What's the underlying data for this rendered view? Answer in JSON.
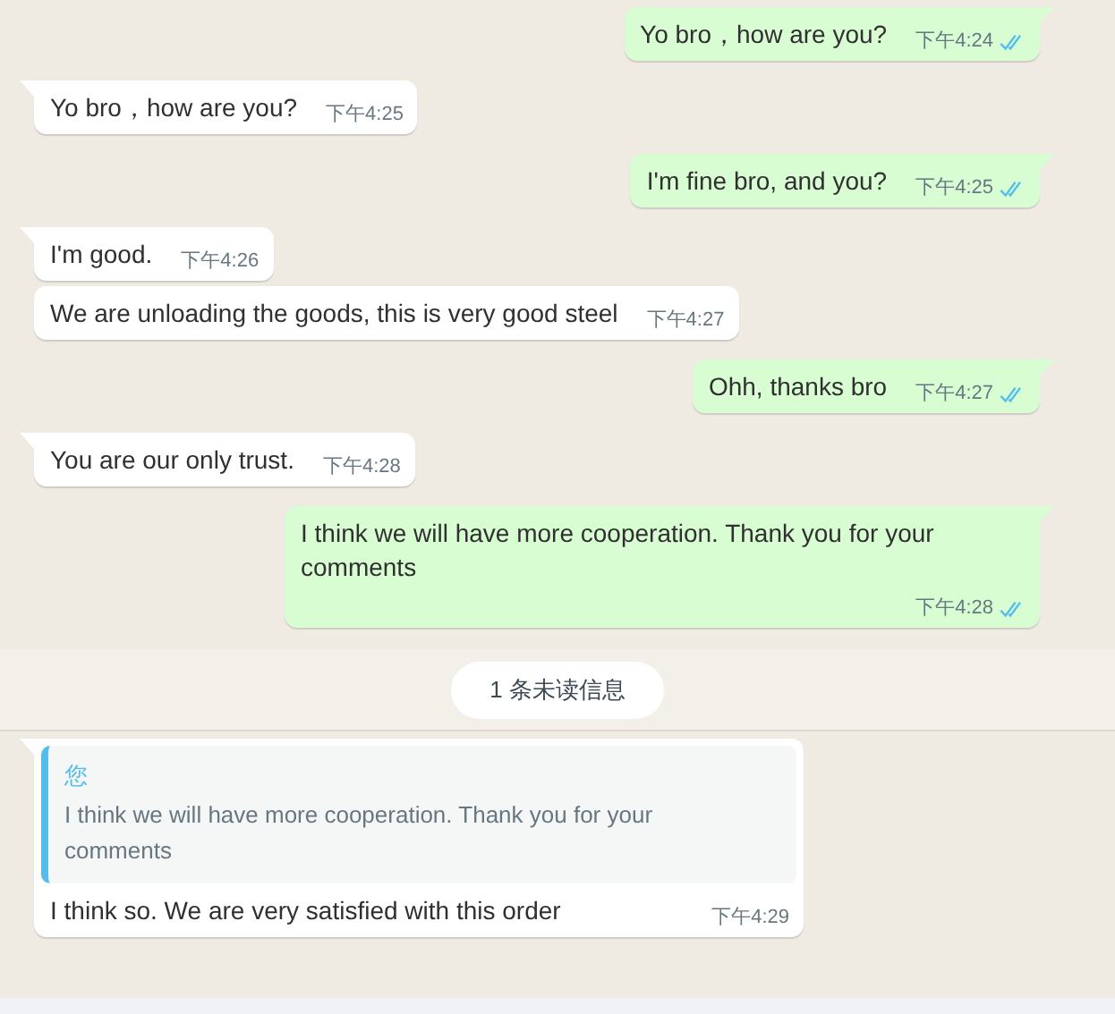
{
  "messages": [
    {
      "kind": "out",
      "tail": true,
      "text": "Yo bro，how are you?",
      "time": "下午4:24",
      "read": true
    },
    {
      "kind": "in",
      "tail": true,
      "text": "Yo bro，how are you?",
      "time": "下午4:25"
    },
    {
      "kind": "out",
      "tail": true,
      "text": "I'm fine bro, and you?",
      "time": "下午4:25",
      "read": true
    },
    {
      "kind": "in",
      "tail": true,
      "text": "I'm good.",
      "time": "下午4:26"
    },
    {
      "kind": "in",
      "tail": false,
      "text": "We are unloading the goods, this is very good steel",
      "time": "下午4:27"
    },
    {
      "kind": "out",
      "tail": true,
      "text": "Ohh, thanks bro",
      "time": "下午4:27",
      "read": true
    },
    {
      "kind": "in",
      "tail": true,
      "text": "You are our only trust.",
      "time": "下午4:28"
    },
    {
      "kind": "out",
      "tail": true,
      "text": "I think we will have more cooperation. Thank you for your comments",
      "time": "下午4:28",
      "read": true
    }
  ],
  "unread_divider": "1 条未读信息",
  "reply": {
    "quote_author": "您",
    "quote_text": "I think we will have more cooperation. Thank you for your comments",
    "text": "I think so. We are very satisfied with this order",
    "time": "下午4:29",
    "tail": true
  }
}
